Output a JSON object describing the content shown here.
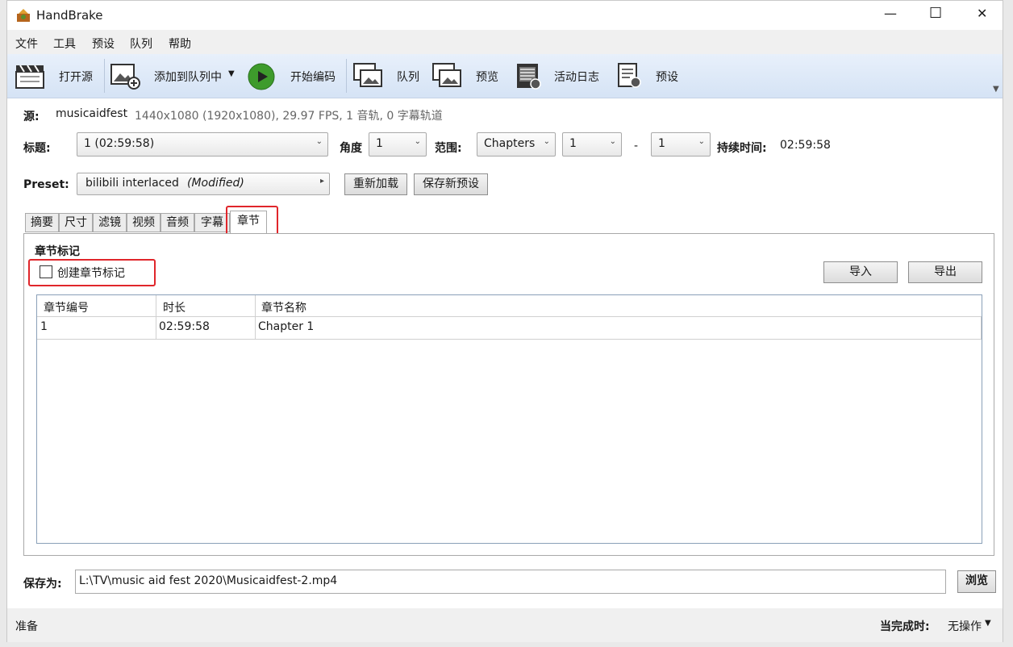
{
  "window": {
    "title": "HandBrake",
    "minimize": "—",
    "maximize": "☐",
    "close": "✕"
  },
  "menu": [
    "文件",
    "工具",
    "预设",
    "队列",
    "帮助"
  ],
  "toolbar": {
    "open_source": "打开源",
    "add_queue": "添加到队列中",
    "start_encode": "开始编码",
    "queue": "队列",
    "preview": "预览",
    "activity_log": "活动日志",
    "presets": "预设"
  },
  "source": {
    "label": "源:",
    "name": "musicaidfest",
    "info": "1440x1080 (1920x1080), 29.97 FPS, 1 音轨, 0 字幕轨道"
  },
  "title_row": {
    "title_label": "标题:",
    "title_value": "1  (02:59:58)",
    "angle_label": "角度",
    "angle_value": "1",
    "range_label": "范围:",
    "range_value": "Chapters",
    "range_start": "1",
    "range_dash": "-",
    "range_end": "1",
    "duration_label": "持续时间:",
    "duration_value": "02:59:58"
  },
  "preset": {
    "label": "Preset:",
    "name": "bilibili interlaced",
    "modified": "(Modified)",
    "reload": "重新加载",
    "save_new": "保存新预设"
  },
  "tabs": [
    "摘要",
    "尺寸",
    "滤镜",
    "视频",
    "音频",
    "字幕",
    "章节"
  ],
  "chapters": {
    "heading": "章节标记",
    "create_markers": "创建章节标记",
    "import": "导入",
    "export": "导出",
    "columns": [
      "章节编号",
      "时长",
      "章节名称"
    ],
    "rows": [
      {
        "num": "1",
        "duration": "02:59:58",
        "name": "Chapter 1"
      }
    ]
  },
  "save": {
    "label": "保存为:",
    "path": "L:\\TV\\music aid fest 2020\\Musicaidfest-2.mp4",
    "browse": "浏览"
  },
  "status": {
    "ready": "准备",
    "when_done_label": "当完成时:",
    "when_done_value": "无操作"
  }
}
